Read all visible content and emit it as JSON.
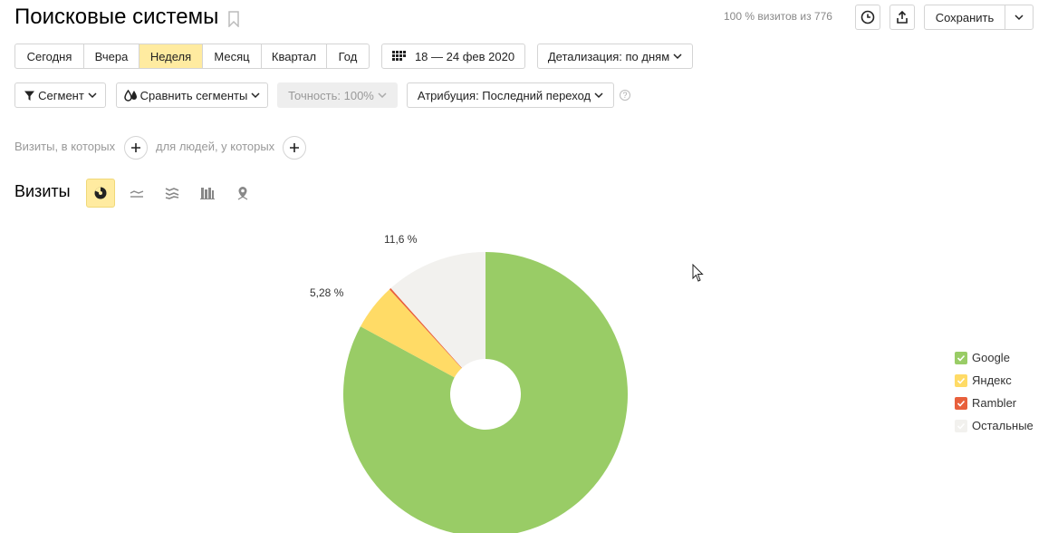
{
  "header": {
    "title": "Поисковые системы",
    "visits_share": "100 % визитов из 776",
    "save_label": "Сохранить"
  },
  "period": {
    "buttons": [
      "Сегодня",
      "Вчера",
      "Неделя",
      "Месяц",
      "Квартал",
      "Год"
    ],
    "active": "Неделя",
    "date_range": "18 — 24 фев 2020",
    "detail": "Детализация: по дням"
  },
  "toolbar": {
    "segment": "Сегмент",
    "compare": "Сравнить сегменты",
    "accuracy": "Точность: 100%",
    "attribution": "Атрибуция: Последний переход",
    "help": "?"
  },
  "filters": {
    "visits_label": "Визиты, в которых",
    "people_label": "для людей, у которых"
  },
  "chart_section": {
    "title": "Визиты",
    "types": [
      "pie-icon",
      "line-icon",
      "area-icon",
      "bar-icon",
      "map-icon"
    ]
  },
  "colors": {
    "google": "#99cc66",
    "yandex": "#ffdb66",
    "rambler": "#e8603c",
    "other": "#f2f1ee",
    "active": "#ffeba0"
  },
  "chart_data": {
    "type": "pie",
    "series": [
      {
        "name": "Google",
        "value": 82.9,
        "color": "#99cc66"
      },
      {
        "name": "Яндекс",
        "value": 5.28,
        "color": "#ffdb66"
      },
      {
        "name": "Rambler",
        "value": 0.2,
        "color": "#e8603c"
      },
      {
        "name": "Остальные",
        "value": 11.6,
        "color": "#f2f1ee"
      }
    ],
    "labels": {
      "other": "11,6 %",
      "yandex": "5,28 %"
    },
    "legend": [
      "Google",
      "Яндекс",
      "Rambler",
      "Остальные"
    ],
    "legend_position": "right"
  }
}
